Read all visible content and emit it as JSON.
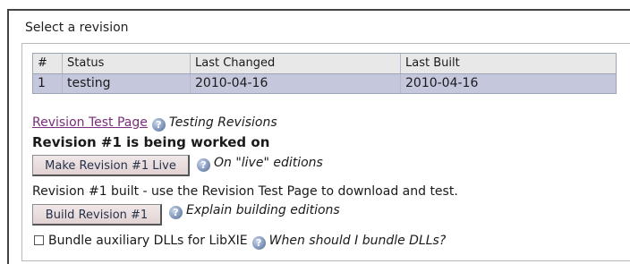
{
  "section": {
    "title": "Select a revision"
  },
  "revisions_table": {
    "headers": [
      "#",
      "Status",
      "Last Changed",
      "Last Built"
    ],
    "rows": [
      [
        "1",
        "testing",
        "2010-04-16",
        "2010-04-16"
      ]
    ],
    "selected_row_color": "#c5c8dc"
  },
  "test_page": {
    "link_label": "Revision Test Page",
    "help_text": "Testing Revisions"
  },
  "status_message": "Revision #1 is being worked on",
  "make_live": {
    "button_label": "Make Revision #1 Live",
    "help_text": "On \"live\" editions"
  },
  "build_message": "Revision #1 built - use the Revision Test Page to download and test.",
  "build": {
    "button_label": "Build Revision #1",
    "help_text": "Explain building editions"
  },
  "bundle": {
    "checkbox_label": "Bundle auxiliary DLLs for LibXIE",
    "checked": false,
    "help_text": "When should I bundle DLLs?"
  },
  "icons": {
    "help": "help-icon"
  }
}
